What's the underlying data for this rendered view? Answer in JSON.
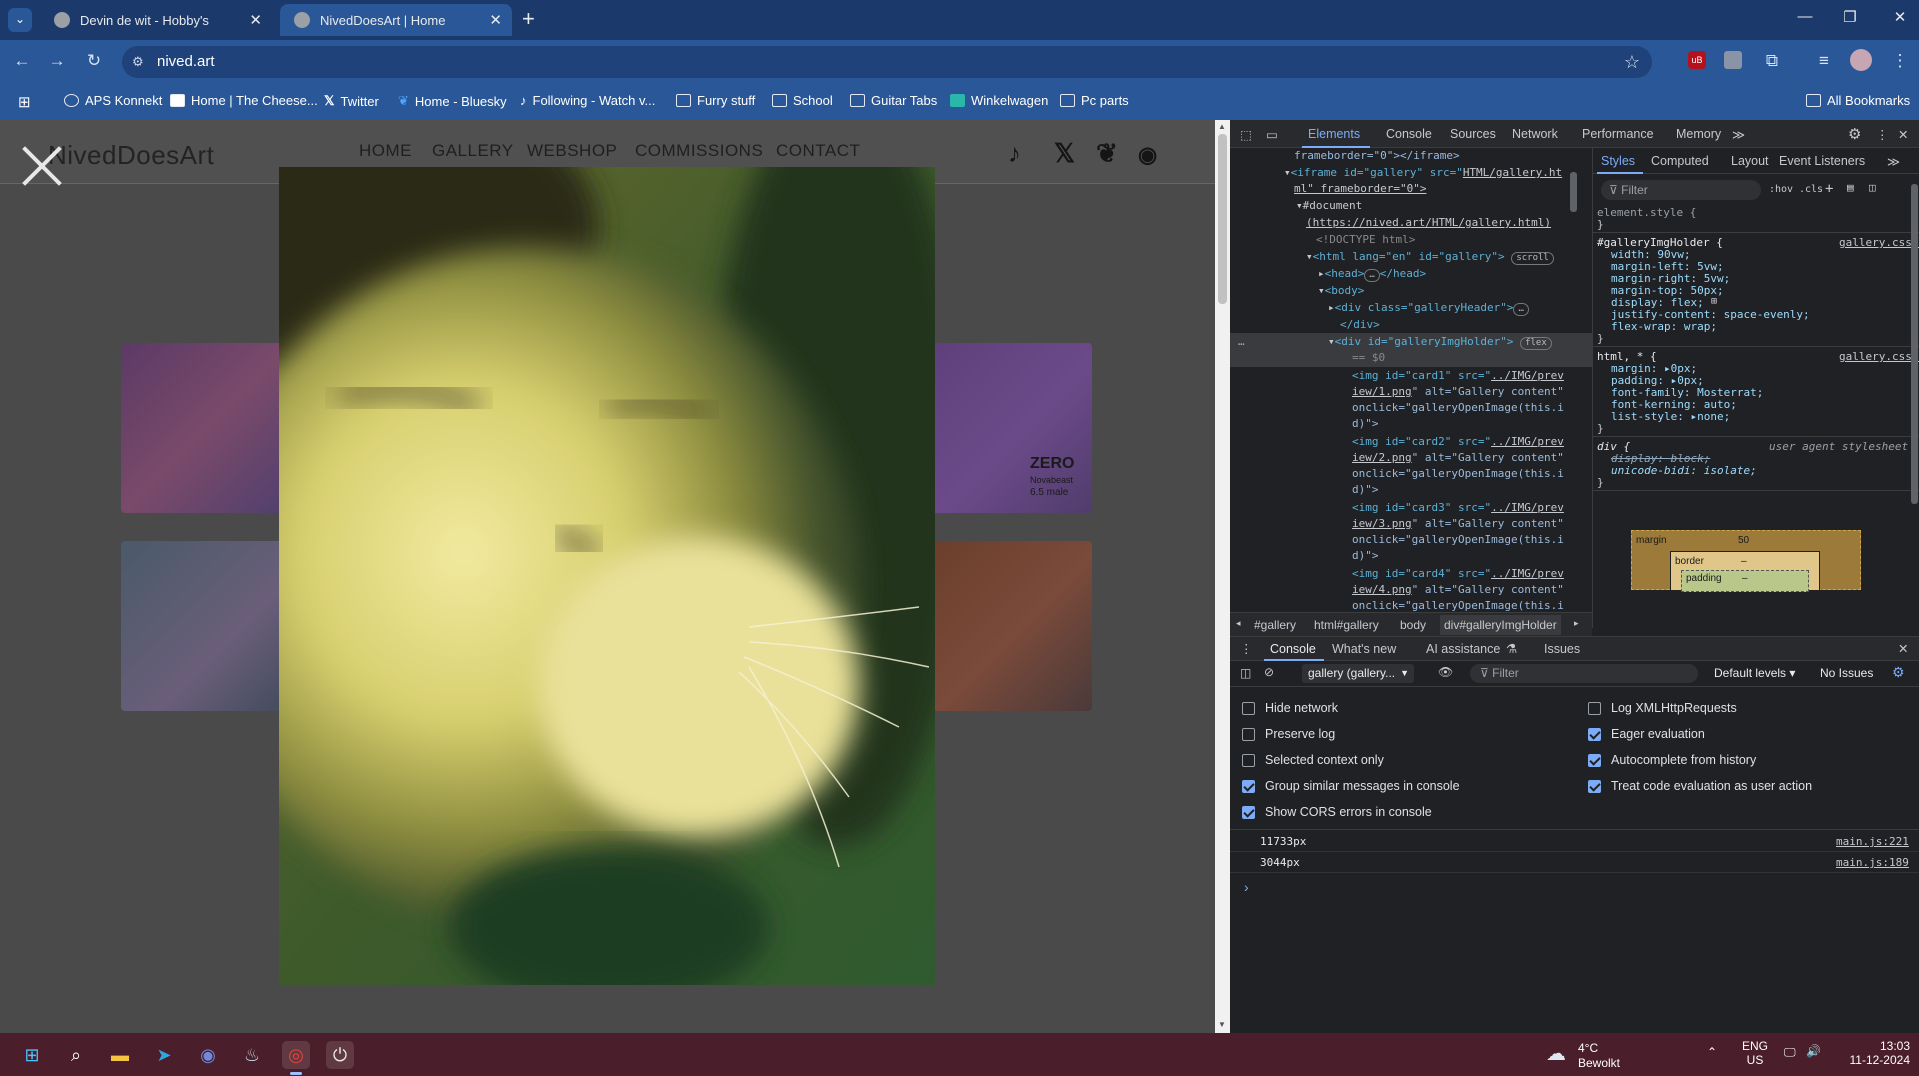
{
  "browser": {
    "tabs": [
      {
        "title": "Devin de wit - Hobby's",
        "close": "✕"
      },
      {
        "title": "NivedDoesArt | Home",
        "close": "✕"
      }
    ],
    "new_tab": "+",
    "address": "nived.art",
    "bookmarks": [
      "APS Konnekt",
      "Home | The Cheese...",
      "Twitter",
      "Home - Bluesky",
      "Following - Watch v...",
      "Furry stuff",
      "School",
      "Guitar Tabs",
      "Winkelwagen",
      "Pc parts"
    ],
    "all_bookmarks": "All Bookmarks"
  },
  "site": {
    "logo": "NivedDoesArt",
    "nav": [
      "HOME",
      "GALLERY",
      "WEBSHOP",
      "COMMISSIONS",
      "CONTACT"
    ],
    "card_text": [
      "ZERO",
      "Novabeast",
      "6.5 male"
    ]
  },
  "devtools": {
    "tabs": [
      "Elements",
      "Console",
      "Sources",
      "Network",
      "Performance",
      "Memory"
    ],
    "elements_lines": {
      "l0": "frameborder=\"0\"></iframe>",
      "l1a": "<iframe id=\"gallery\" src=\"",
      "l1b": "HTML/gallery.ht",
      "l2": "ml\" frameborder=\"0\">",
      "l3": "#document",
      "l4": "(https://nived.art/HTML/gallery.html)",
      "l5": "<!DOCTYPE html>",
      "l6": "<html lang=\"en\" id=\"gallery\">",
      "l6pill": "scroll",
      "l7": "<head>",
      "l7b": "</head>",
      "l8": "<body>",
      "l9": "<div class=\"galleryHeader\">",
      "l10": "</div>",
      "l11": "<div id=\"galleryImgHolder\">",
      "l11pill": "flex",
      "l12": "== $0",
      "img1a": "<img id=\"card1\" src=\"",
      "img1b": "../IMG/prev",
      "img1c": "iew/1.png",
      "img2a": "<img id=\"card2\" src=\"",
      "img2b": "../IMG/prev",
      "img2c": "iew/2.png",
      "img3a": "<img id=\"card3\" src=\"",
      "img3b": "../IMG/prev",
      "img3c": "iew/3.png",
      "img4a": "<img id=\"card4\" src=\"",
      "img4b": "../IMG/prev",
      "img4c": "iew/4.png",
      "alt": "\" alt=\"Gallery content\"",
      "onclick": "onclick=\"galleryOpenImage(this.i",
      "close": "d)\">"
    },
    "crumbs": [
      "#gallery",
      "html#gallery",
      "body",
      "div#galleryImgHolder"
    ],
    "styles_tabs": [
      "Styles",
      "Computed",
      "Layout",
      "Event Listeners"
    ],
    "filter": "Filter",
    "hov": ":hov",
    "cls": ".cls",
    "rules": {
      "element_style": "element.style {",
      "holder_sel": "#galleryImgHolder {",
      "holder_src": "gallery.css:51",
      "holder_props": [
        "width: 90vw;",
        "margin-left: 5vw;",
        "margin-right: 5vw;",
        "margin-top: 50px;",
        "display: flex;",
        "justify-content: space-evenly;",
        "flex-wrap: wrap;"
      ],
      "html_sel": "html, * {",
      "html_src": "gallery.css:12",
      "html_props": [
        "margin: ▸0px;",
        "padding: ▸0px;",
        "font-family: Mosterrat;",
        "font-kerning: auto;",
        "list-style: ▸none;"
      ],
      "div_sel": "div {",
      "div_src": "user agent stylesheet",
      "div_props": [
        "display: block;",
        "unicode-bidi: isolate;"
      ],
      "close": "}"
    },
    "boxmodel": {
      "margin": "margin",
      "margin_val": "50",
      "border": "border",
      "border_val": "–",
      "padding": "padding",
      "padding_val": "–"
    },
    "drawer_tabs": [
      "Console",
      "What's new",
      "AI assistance",
      "Issues"
    ],
    "context": "gallery (gallery...",
    "console_filter": "Filter",
    "levels": "Default levels",
    "issues": "No Issues",
    "settings_left": [
      {
        "label": "Hide network",
        "checked": false
      },
      {
        "label": "Preserve log",
        "checked": false
      },
      {
        "label": "Selected context only",
        "checked": false
      },
      {
        "label": "Group similar messages in console",
        "checked": true
      },
      {
        "label": "Show CORS errors in console",
        "checked": true
      }
    ],
    "settings_right": [
      {
        "label": "Log XMLHttpRequests",
        "checked": false
      },
      {
        "label": "Eager evaluation",
        "checked": true
      },
      {
        "label": "Autocomplete from history",
        "checked": true
      },
      {
        "label": "Treat code evaluation as user action",
        "checked": true
      }
    ],
    "logs": [
      {
        "text": "11733px",
        "source": "main.js:221"
      },
      {
        "text": "3044px",
        "source": "main.js:189"
      }
    ],
    "prompt": "›"
  },
  "taskbar": {
    "weather_temp": "4°C",
    "weather_desc": "Bewolkt",
    "lang1": "ENG",
    "lang2": "US",
    "time": "13:03",
    "date": "11-12-2024"
  }
}
